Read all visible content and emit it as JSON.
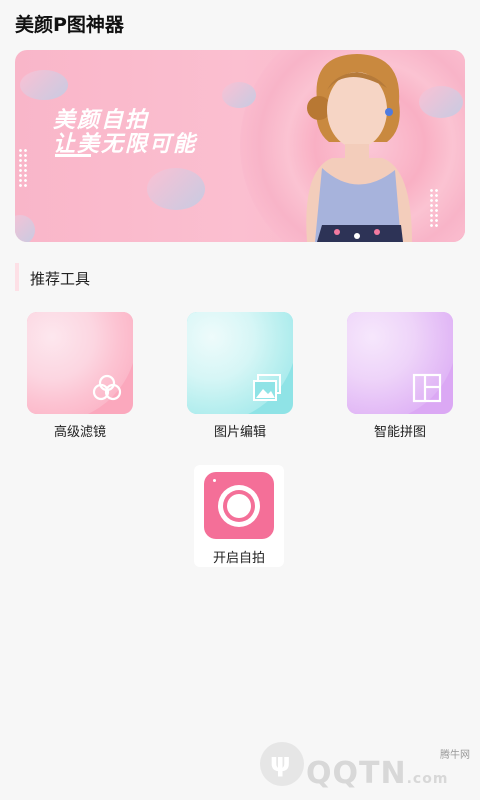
{
  "app": {
    "title": "美颜P图神器"
  },
  "banner": {
    "line1": "美颜自拍",
    "line2": "让美无限可能"
  },
  "section": {
    "title": "推荐工具"
  },
  "tools": [
    {
      "label": "高级滤镜",
      "icon": "filter-circles-icon",
      "color": "#fba8bd"
    },
    {
      "label": "图片编辑",
      "icon": "image-edit-icon",
      "color": "#8fe3e6"
    },
    {
      "label": "智能拼图",
      "icon": "collage-layout-icon",
      "color": "#dba8f4"
    }
  ],
  "selfie": {
    "label": "开启自拍",
    "icon": "camera-icon",
    "color": "#f46f98"
  },
  "watermark": {
    "small": "腾牛网",
    "brand": "QQTN",
    "suffix": ".com"
  }
}
